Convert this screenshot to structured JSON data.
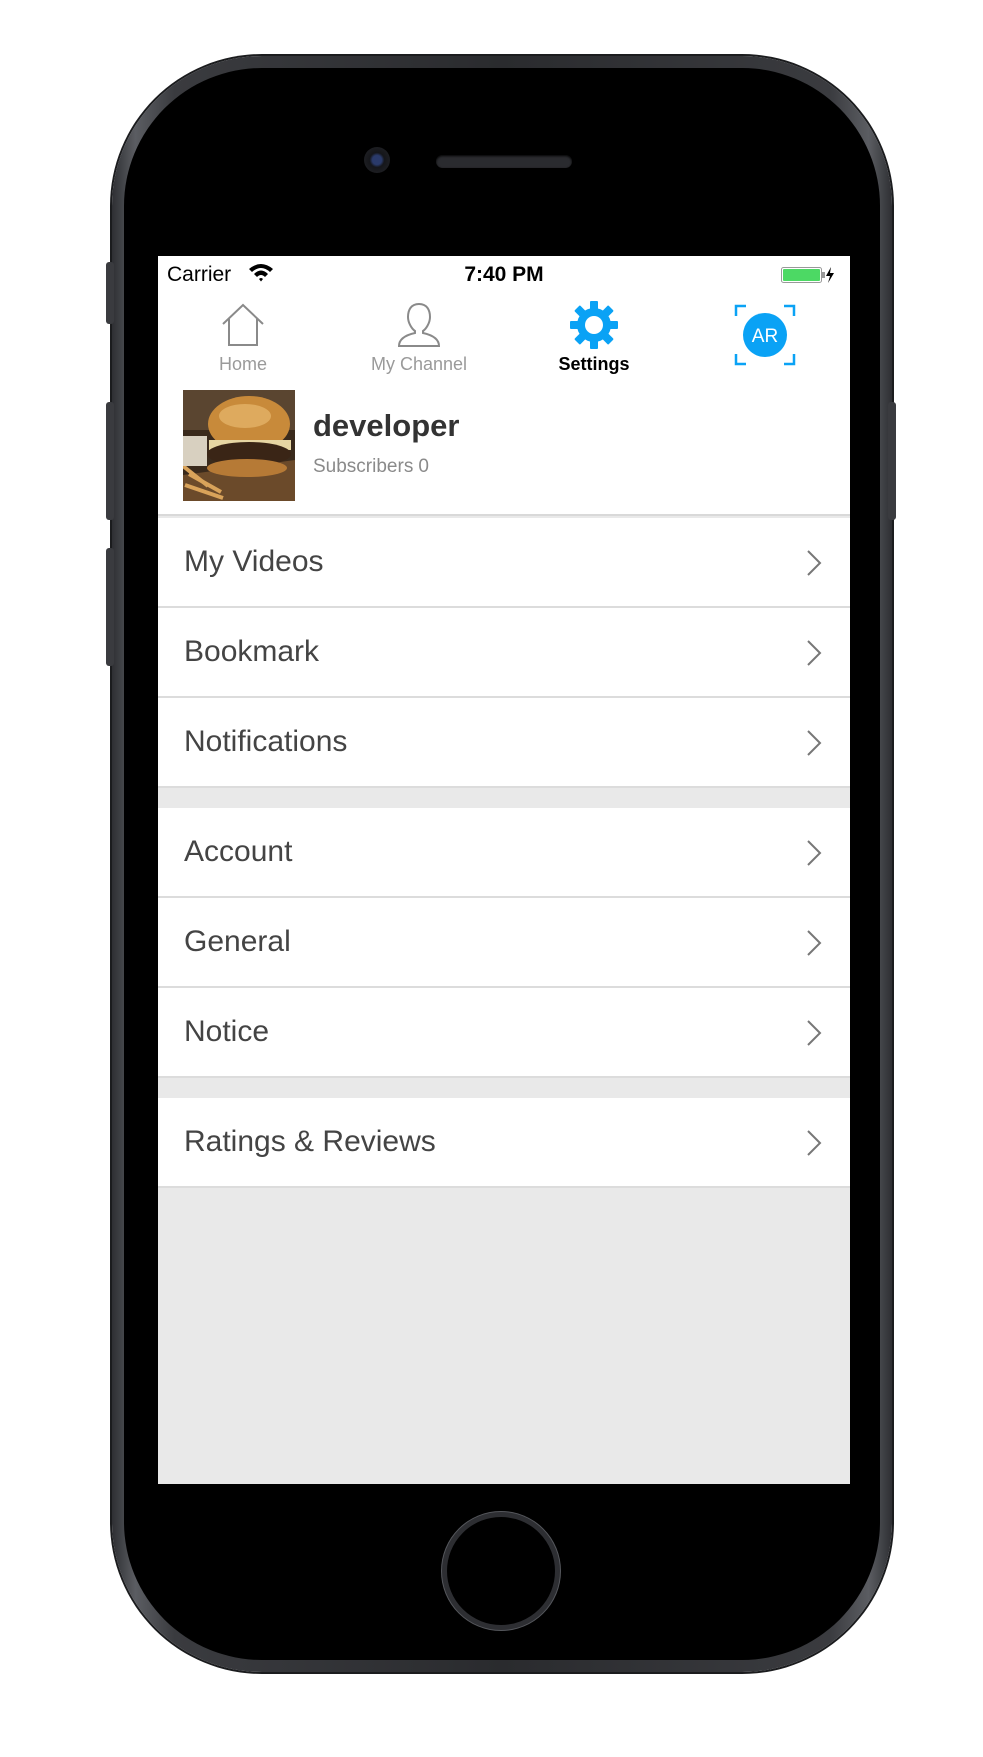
{
  "status_bar": {
    "carrier": "Carrier",
    "time": "7:40 PM",
    "battery_color": "#4cd964"
  },
  "tabs": [
    {
      "label": "Home",
      "icon": "home-icon",
      "active": false
    },
    {
      "label": "My Channel",
      "icon": "person-icon",
      "active": false
    },
    {
      "label": "Settings",
      "icon": "gear-icon",
      "active": true
    }
  ],
  "ar_button": {
    "label": "AR",
    "color": "#0aa2f5"
  },
  "profile": {
    "name": "developer",
    "subscribers_label": "Subscribers",
    "subscribers_count": "0",
    "avatar": "burger-photo"
  },
  "menu": {
    "group1": [
      {
        "label": "My Videos"
      },
      {
        "label": "Bookmark"
      },
      {
        "label": "Notifications"
      }
    ],
    "group2": [
      {
        "label": "Account"
      },
      {
        "label": "General"
      },
      {
        "label": "Notice"
      }
    ],
    "group3": [
      {
        "label": "Ratings & Reviews"
      }
    ]
  },
  "colors": {
    "accent": "#0aa2f5",
    "background": "#e9e9e9"
  }
}
